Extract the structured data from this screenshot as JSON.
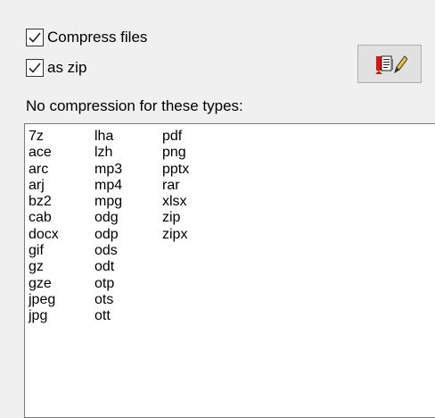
{
  "options": {
    "compress_files": {
      "label": "Compress files",
      "checked": true
    },
    "as_zip": {
      "label": "as zip",
      "checked": true
    }
  },
  "edit_button": {
    "icon": "edit-types-icon"
  },
  "no_compression": {
    "label": "No compression for these types:",
    "columns": [
      [
        "7z",
        "ace",
        "arc",
        "arj",
        "bz2",
        "cab",
        "docx",
        "gif",
        "gz",
        "gze",
        "jpeg",
        "jpg"
      ],
      [
        "lha",
        "lzh",
        "mp3",
        "mp4",
        "mpg",
        "odg",
        "odp",
        "ods",
        "odt",
        "otp",
        "ots",
        "ott"
      ],
      [
        "pdf",
        "png",
        "pptx",
        "rar",
        "xlsx",
        "zip",
        "zipx"
      ]
    ]
  }
}
